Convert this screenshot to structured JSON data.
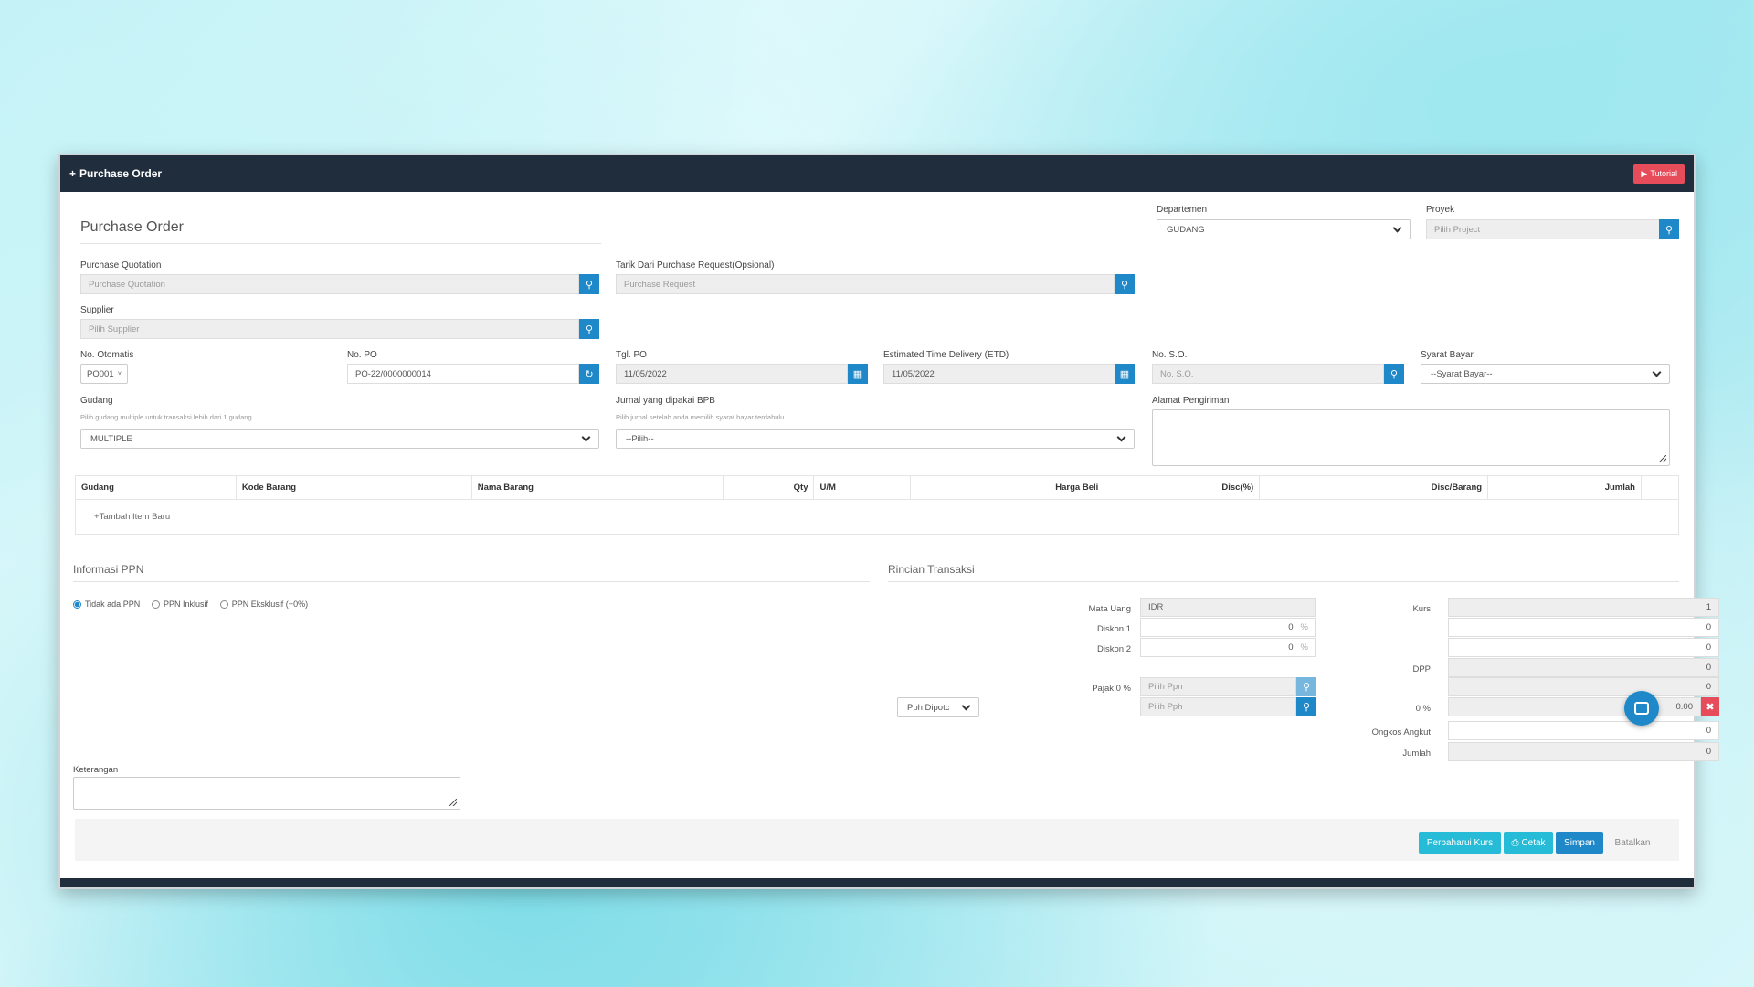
{
  "window": {
    "title": "Purchase Order",
    "tutorial_label": "Tutorial"
  },
  "form": {
    "heading": "Purchase Order",
    "departemen": {
      "label": "Departemen",
      "value": "GUDANG"
    },
    "proyek": {
      "label": "Proyek",
      "placeholder": "Pilih Project"
    },
    "purchase_quotation": {
      "label": "Purchase Quotation",
      "placeholder": "Purchase Quotation"
    },
    "tarik_pr": {
      "label": "Tarik Dari Purchase Request(Opsional)",
      "placeholder": "Purchase Request"
    },
    "supplier": {
      "label": "Supplier",
      "placeholder": "Pilih Supplier"
    },
    "no_otomatis": {
      "label": "No. Otomatis",
      "value": "PO001"
    },
    "no_po": {
      "label": "No. PO",
      "value": "PO-22/0000000014"
    },
    "tgl_po": {
      "label": "Tgl. PO",
      "value": "11/05/2022"
    },
    "etd": {
      "label": "Estimated Time Delivery (ETD)",
      "value": "11/05/2022"
    },
    "no_so": {
      "label": "No. S.O.",
      "placeholder": "No. S.O."
    },
    "syarat_bayar": {
      "label": "Syarat Bayar",
      "value": "--Syarat Bayar--"
    },
    "gudang": {
      "label": "Gudang",
      "hint": "Pilih gudang multiple untuk transaksi lebih dari 1 gudang",
      "value": "MULTIPLE"
    },
    "jurnal": {
      "label": "Jurnal yang dipakai BPB",
      "hint": "Pilih jurnal setelah anda memilih syarat bayar terdahulu",
      "value": "--Pilih--"
    },
    "alamat": {
      "label": "Alamat Pengiriman"
    }
  },
  "items_table": {
    "headers": [
      "Gudang",
      "Kode Barang",
      "Nama Barang",
      "Qty",
      "U/M",
      "Harga Beli",
      "Disc(%)",
      "Disc/Barang",
      "Jumlah"
    ],
    "add_item_label": "Tambah Item Baru"
  },
  "ppn": {
    "title": "Informasi PPN",
    "options": [
      "Tidak ada PPN",
      "PPN Inklusif",
      "PPN Eksklusif (+0%)"
    ],
    "selected": 0
  },
  "rincian": {
    "title": "Rincian Transaksi",
    "mata_uang": {
      "label": "Mata Uang",
      "value": "IDR"
    },
    "diskon1": {
      "label": "Diskon 1",
      "value": "0",
      "unit": "%"
    },
    "diskon2": {
      "label": "Diskon 2",
      "value": "0",
      "unit": "%"
    },
    "pajak": {
      "label": "Pajak 0 %",
      "placeholder": "Pilih Ppn"
    },
    "pph_select": "Pph Dipotc",
    "pph": {
      "placeholder": "Pilih Pph"
    },
    "kurs": {
      "label": "Kurs",
      "value": "1"
    },
    "right_values": [
      "0",
      "0"
    ],
    "dpp": {
      "label": "DPP",
      "value": "0"
    },
    "ppn_row_value": "0",
    "pph_pct": {
      "label": "0 %",
      "value": "0.00"
    },
    "ongkos": {
      "label": "Ongkos Angkut",
      "value": "0"
    },
    "jumlah": {
      "label": "Jumlah",
      "value": "0"
    }
  },
  "keterangan": {
    "label": "Keterangan"
  },
  "buttons": {
    "perbaharui": "Perbaharui Kurs",
    "cetak": "Cetak",
    "simpan": "Simpan",
    "batalkan": "Batalkan"
  },
  "colors": {
    "primary": "#1e88c9",
    "teal": "#26bcd7",
    "danger": "#e74c5b",
    "header": "#1f2d3d"
  }
}
